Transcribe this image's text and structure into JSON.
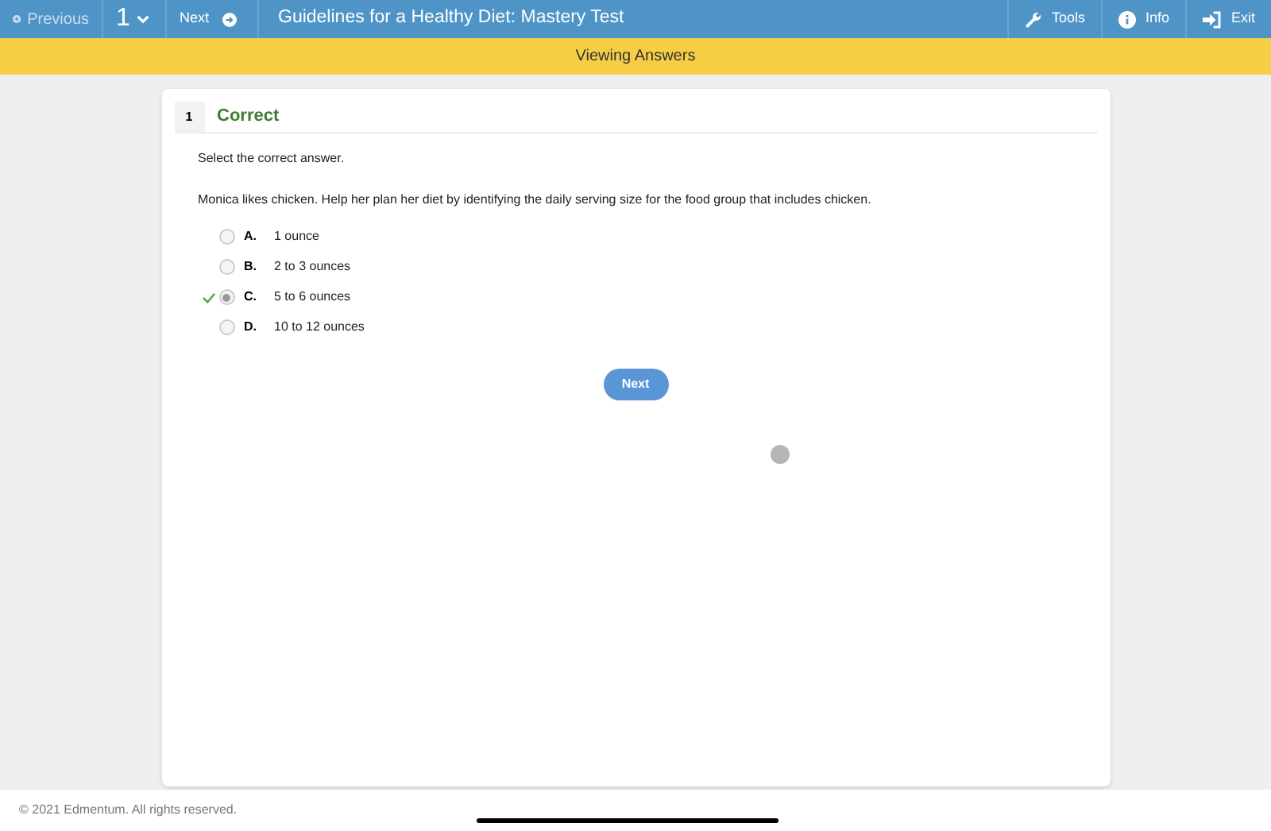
{
  "toolbar": {
    "previous": {
      "label": "Previous",
      "disabled": true
    },
    "question_number": "1",
    "next": {
      "label": "Next",
      "disabled": false
    },
    "title": "Guidelines for a Healthy Diet: Mastery Test",
    "tools": [
      {
        "label": "Tools",
        "kind": "wrench"
      },
      {
        "label": "Info",
        "kind": "info"
      },
      {
        "label": "Exit",
        "kind": "exit"
      }
    ]
  },
  "banner": "Viewing Answers",
  "question": {
    "number": "1",
    "status": "Correct",
    "instruction": "Select the correct answer.",
    "prompt": "Monica likes chicken. Help her plan her diet by identifying the daily serving size for the food group that includes chicken.",
    "choices": [
      {
        "letter": "A.",
        "text": "1 ounce",
        "selected": false,
        "correct": false
      },
      {
        "letter": "B.",
        "text": "2 to 3 ounces",
        "selected": false,
        "correct": false
      },
      {
        "letter": "C.",
        "text": "5 to 6 ounces",
        "selected": true,
        "correct": true
      },
      {
        "letter": "D.",
        "text": "10 to 12 ounces",
        "selected": false,
        "correct": false
      }
    ],
    "next_button": "Next"
  },
  "footer": "© 2021 Edmentum. All rights reserved."
}
